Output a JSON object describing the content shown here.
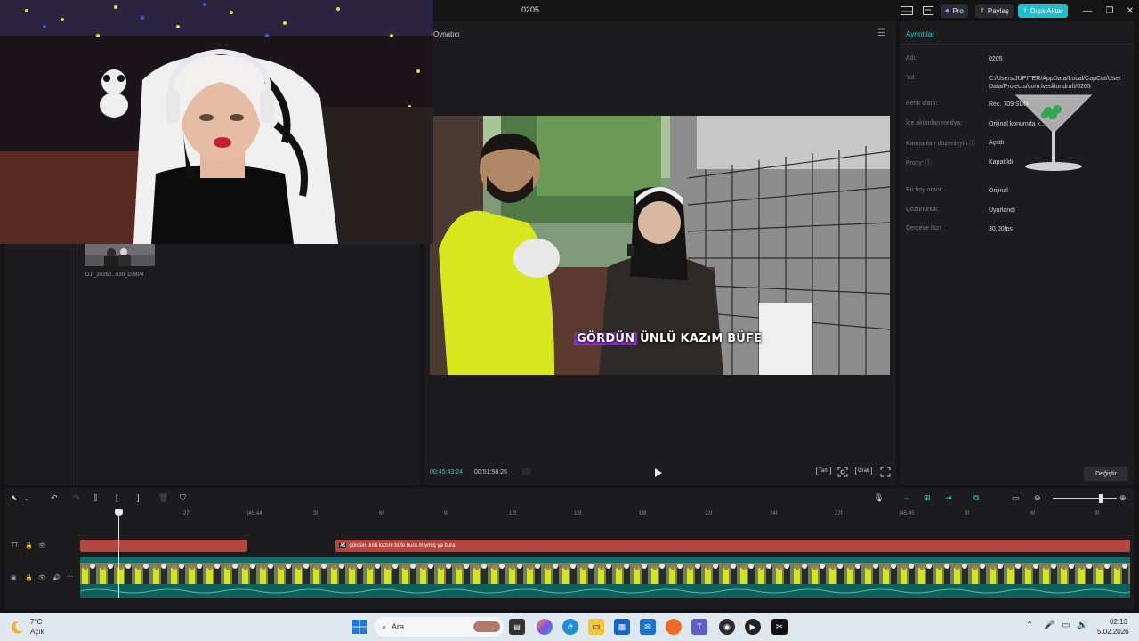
{
  "app": {
    "project_title": "0205",
    "pro_label": "Pro",
    "share_label": "Paylaş",
    "export_label": "Dışa Aktar"
  },
  "media": {
    "filename": "DJI_20260...030_D.MP4"
  },
  "player": {
    "title": "Oynatıcı",
    "time_current": "00:45:43:24",
    "time_total": "00:51:58:26",
    "subtitle_highlight": "GÖRDÜN",
    "subtitle_rest": "ÜNLÜ KAZıM BÜFE",
    "btn_full": "Tam",
    "btn_ratio": "Oran"
  },
  "details": {
    "title": "Ayrıntılar",
    "rows": [
      {
        "label": "Adı:",
        "value": "0205"
      },
      {
        "label": "Yol:",
        "value": "C:/Users/JÜPİTER/AppData/Local/CapCut/User Data/Projects/com.lveditor.draft/0205"
      },
      {
        "label": "Renk alanı:",
        "value": "Rec. 709 SDR"
      },
      {
        "label": "İçe aktarılan medya:",
        "value": "Orijinal konumda k..."
      },
      {
        "label": "Katmanları düzenleyin ⓘ",
        "value": "Açıldı"
      },
      {
        "label": "Proxy: ⓘ",
        "value": "Kapatıldı"
      },
      {
        "label": "En boy oranı:",
        "value": "Orijinal"
      },
      {
        "label": "Çözünürlük:",
        "value": "Uyarlandı"
      },
      {
        "label": "Çerçeve hızı:",
        "value": "30.00fps"
      }
    ],
    "change_label": "Değiştir"
  },
  "timeline": {
    "ticks": [
      "f",
      "27f",
      "|45:44",
      "3f",
      "6f",
      "9f",
      "12f",
      "15f",
      "18f",
      "21f",
      "24f",
      "27f",
      "|45:45",
      "3f",
      "6f",
      "9f"
    ],
    "text_clip_label": "gördün ünlü kazım büfe bura mıymış ya bura",
    "text_clip_tag": "A5"
  },
  "taskbar": {
    "temp": "7°C",
    "condition": "Açık",
    "search_placeholder": "Ara",
    "time": "02:13",
    "date": "5.02.2026"
  },
  "colors": {
    "accent": "#2fd0dc",
    "text_clip": "#b4463f",
    "video_track": "#0f6e68",
    "subtitle_highlight": "#8a2fc7"
  }
}
